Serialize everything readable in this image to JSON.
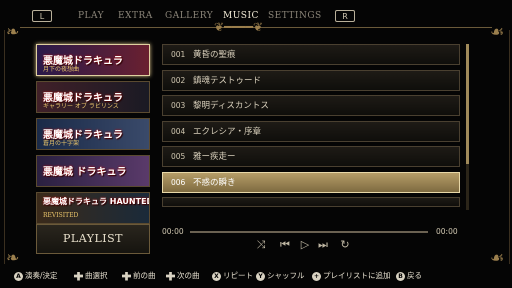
{
  "topbar": {
    "left_shoulder": "L",
    "right_shoulder": "R",
    "tabs": [
      {
        "label": "PLAY",
        "active": false
      },
      {
        "label": "EXTRA",
        "active": false
      },
      {
        "label": "GALLERY",
        "active": false
      },
      {
        "label": "MUSIC",
        "active": true
      },
      {
        "label": "SETTINGS",
        "active": false
      }
    ]
  },
  "games": [
    {
      "title": "悪魔城ドラキュラ",
      "subtitle": "月下の夜想曲",
      "selected": true,
      "colors": [
        "#2a1a4a",
        "#6a2030"
      ]
    },
    {
      "title": "悪魔城ドラキュラ",
      "subtitle": "ギャラリー オブ ラビリンス",
      "selected": false,
      "colors": [
        "#402028",
        "#1a1a24"
      ]
    },
    {
      "title": "悪魔城ドラキュラ",
      "subtitle": "蒼月の十字架",
      "selected": false,
      "colors": [
        "#1a2a48",
        "#3a4a6a"
      ]
    },
    {
      "title": "悪魔城 ドラキュラ",
      "subtitle": "",
      "selected": false,
      "colors": [
        "#2a2040",
        "#5a3a6a"
      ]
    },
    {
      "title": "悪魔城ドラキュラ HAUNTED CASTLE",
      "subtitle": "REVISITED",
      "selected": false,
      "colors": [
        "#3a2a1a",
        "#1a2a3a"
      ]
    }
  ],
  "playlist_label": "PLAYLIST",
  "tracks": [
    {
      "num": "001",
      "title": "黄昏の聖痕",
      "selected": false
    },
    {
      "num": "002",
      "title": "鎮魂テストゥード",
      "selected": false
    },
    {
      "num": "003",
      "title": "黎明ディスカントス",
      "selected": false
    },
    {
      "num": "004",
      "title": "エクレシア・序章",
      "selected": false
    },
    {
      "num": "005",
      "title": "雅ー疾走ー",
      "selected": false
    },
    {
      "num": "006",
      "title": "不惑の瞬き",
      "selected": true
    }
  ],
  "player": {
    "elapsed": "00:00",
    "total": "00:00",
    "progress": 0
  },
  "controls": [
    {
      "name": "shuffle-icon",
      "glyph": "⤨"
    },
    {
      "name": "previous-icon",
      "glyph": "⏮"
    },
    {
      "name": "play-icon",
      "glyph": "▷"
    },
    {
      "name": "next-icon",
      "glyph": "⏭"
    },
    {
      "name": "repeat-icon",
      "glyph": "↻"
    }
  ],
  "help": [
    {
      "btn": "A",
      "type": "circle",
      "label": "演奏/決定"
    },
    {
      "btn": "+",
      "type": "plus",
      "label": "曲選択"
    },
    {
      "btn": "+",
      "type": "plus",
      "label": "前の曲"
    },
    {
      "btn": "+",
      "type": "plus",
      "label": "次の曲"
    },
    {
      "btn": "X",
      "type": "circle",
      "label": "リピート"
    },
    {
      "btn": "Y",
      "type": "circle",
      "label": "シャッフル"
    },
    {
      "btn": "+",
      "type": "circle",
      "label": "プレイリストに追加"
    },
    {
      "btn": "B",
      "type": "circle",
      "label": "戻る"
    }
  ]
}
